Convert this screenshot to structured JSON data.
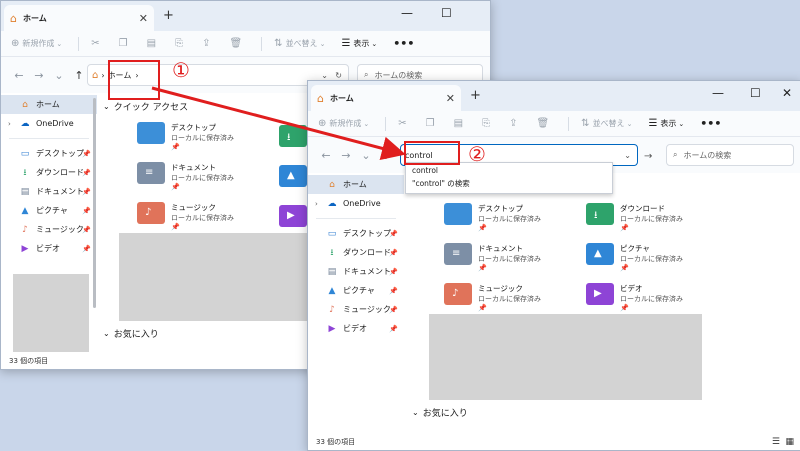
{
  "window1": {
    "tab_title": "ホーム",
    "new_tab": "+",
    "controls": {
      "minimize": "—",
      "maximize": "☐",
      "close": "✕"
    },
    "toolbar": {
      "new": "新規作成",
      "sort": "並べ替え",
      "view": "表示",
      "more": "•••"
    },
    "address_root": "ホーム",
    "address_sep": "›",
    "search_placeholder": "ホームの検索",
    "sidebar": {
      "home": "ホーム",
      "onedrive": "OneDrive",
      "items": [
        {
          "label": "デスクトップ",
          "icon": "desktop-icon"
        },
        {
          "label": "ダウンロード",
          "icon": "download-icon"
        },
        {
          "label": "ドキュメント",
          "icon": "document-icon"
        },
        {
          "label": "ピクチャ",
          "icon": "pictures-icon"
        },
        {
          "label": "ミュージック",
          "icon": "music-icon"
        },
        {
          "label": "ビデオ",
          "icon": "video-icon"
        }
      ]
    },
    "quick_access": "クイック アクセス",
    "folders": [
      {
        "name": "デスクトップ",
        "sub": "ローカルに保存済み"
      },
      {
        "name": "ドキュメント",
        "sub": "ローカルに保存済み"
      },
      {
        "name": "ミュージック",
        "sub": "ローカルに保存済み"
      }
    ],
    "favorites": "お気に入り",
    "status": "33 個の項目"
  },
  "window2": {
    "tab_title": "ホーム",
    "new_tab": "+",
    "controls": {
      "minimize": "—",
      "maximize": "☐",
      "close": "✕"
    },
    "toolbar": {
      "new": "新規作成",
      "sort": "並べ替え",
      "view": "表示",
      "more": "•••"
    },
    "address_value": "control",
    "search_placeholder": "ホームの検索",
    "suggestions": [
      "control",
      "\"control\" の検索"
    ],
    "sidebar": {
      "home": "ホーム",
      "onedrive": "OneDrive",
      "items": [
        {
          "label": "デスクトップ",
          "icon": "desktop-icon"
        },
        {
          "label": "ダウンロード",
          "icon": "download-icon"
        },
        {
          "label": "ドキュメント",
          "icon": "document-icon"
        },
        {
          "label": "ピクチャ",
          "icon": "pictures-icon"
        },
        {
          "label": "ミュージック",
          "icon": "music-icon"
        },
        {
          "label": "ビデオ",
          "icon": "video-icon"
        }
      ]
    },
    "folders": [
      {
        "name": "デスクトップ",
        "sub": "ローカルに保存済み"
      },
      {
        "name": "ダウンロード",
        "sub": "ローカルに保存済み"
      },
      {
        "name": "ドキュメント",
        "sub": "ローカルに保存済み"
      },
      {
        "name": "ピクチャ",
        "sub": "ローカルに保存済み"
      },
      {
        "name": "ミュージック",
        "sub": "ローカルに保存済み"
      },
      {
        "name": "ビデオ",
        "sub": "ローカルに保存済み"
      }
    ],
    "favorites": "お気に入り",
    "status": "33 個の項目"
  },
  "annotations": {
    "step1": "①",
    "step2": "②",
    "color": "#e01e1e"
  },
  "colors": {
    "accent": "#0067c0",
    "folder_blue": "#3c8fd8",
    "download_green": "#2ea36b",
    "doc_gray": "#7d8fa6",
    "picture_blue": "#2f86d6",
    "music_orange": "#e0735a",
    "video_purple": "#8e44d6"
  }
}
